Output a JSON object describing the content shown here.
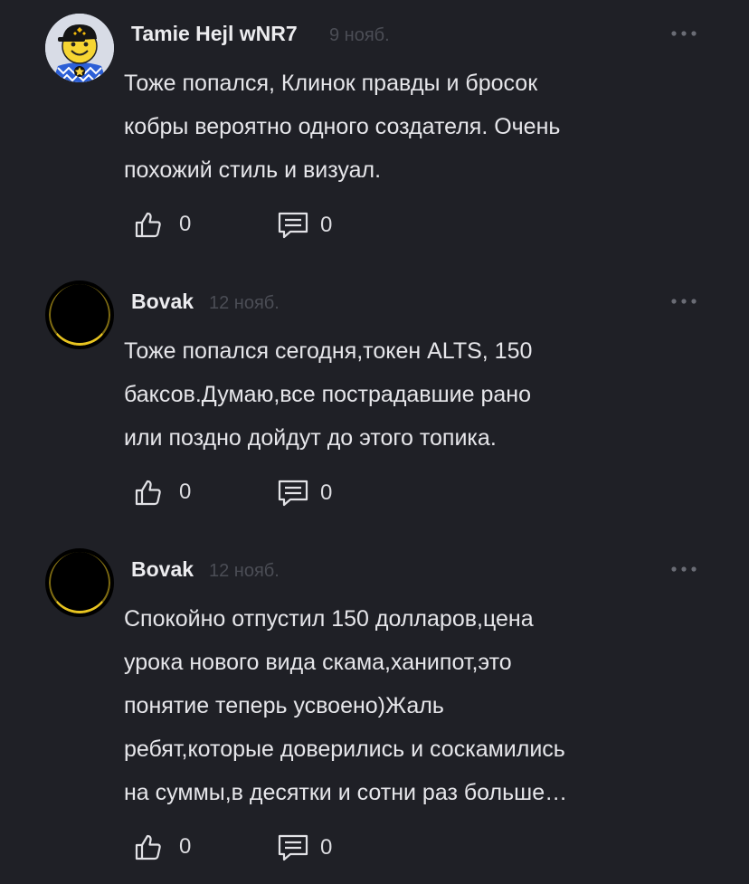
{
  "comments": [
    {
      "author": "Tamie Hejl wNR7",
      "date": "9 нояб.",
      "avatar": "smiley-cap-avatar",
      "text_lines": [
        " Тоже попался, Клинок правды и бросок",
        "кобры вероятно одного создателя. Очень",
        "похожий стиль и визуал."
      ],
      "likes": "0",
      "replies": "0"
    },
    {
      "author": "Bovak",
      "date": "12 нояб.",
      "avatar": "dark-eclipse-avatar",
      "text_lines": [
        " Тоже попался сегодня,токен ALTS, 150",
        "баксов.Думаю,все пострадавшие рано",
        "или поздно дойдут до этого топика."
      ],
      "likes": "0",
      "replies": "0"
    },
    {
      "author": "Bovak",
      "date": "12 нояб.",
      "avatar": "dark-eclipse-avatar",
      "text_lines": [
        " Спокойно отпустил 150 долларов,цена",
        "урока нового вида скама,ханипот,это",
        "понятие теперь усвоено)Жаль",
        "ребят,которые доверились и соскамились",
        "на суммы,в десятки и сотни раз больше…"
      ],
      "likes": "0",
      "replies": "0"
    }
  ],
  "icons": {
    "like": "thumbs-up-icon",
    "reply": "comment-icon",
    "more": "more-dots-icon"
  },
  "colors": {
    "background": "#1f2026",
    "text": "#e6e6ea",
    "date": "#4b4d55",
    "avatar_ring": "#e8c420"
  }
}
